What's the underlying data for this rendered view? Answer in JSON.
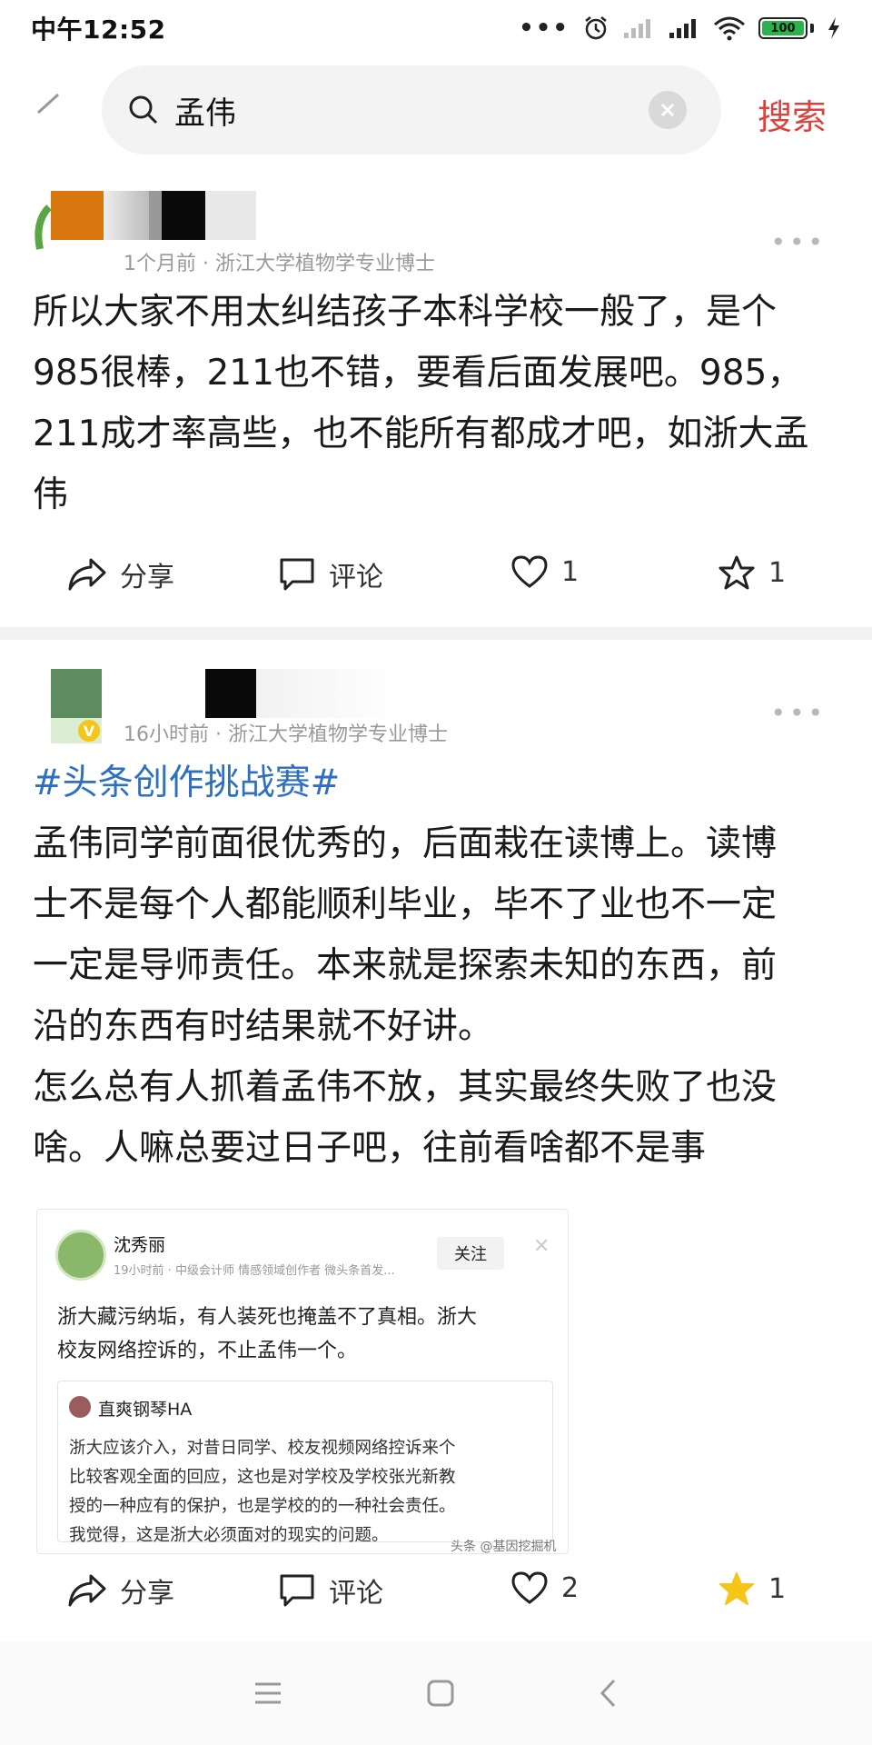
{
  "status_bar": {
    "time": "中午12:52",
    "battery": "100"
  },
  "search": {
    "query": "孟伟",
    "button_label": "搜索"
  },
  "posts": [
    {
      "meta": "1个月前 · 浙江大学植物学专业博士",
      "text_lines": [
        "所以大家不用太纠结孩子本科学校一般了，是个",
        "985很棒，211也不错，要看后面发展吧。985，",
        "211成才率高些，也不能所有都成才吧，如浙大孟",
        "伟"
      ],
      "actions": {
        "share": "分享",
        "comment": "评论",
        "likes": "1",
        "favorites": "1"
      }
    },
    {
      "meta": "16小时前 · 浙江大学植物学专业博士",
      "hashtag": "#头条创作挑战赛#",
      "text_lines": [
        "孟伟同学前面很优秀的，后面栽在读博上。读博",
        "士不是每个人都能顺利毕业，毕不了业也不一定",
        "一定是导师责任。本来就是探索未知的东西，前",
        "沿的东西有时结果就不好讲。",
        "怎么总有人抓着孟伟不放，其实最终失败了也没",
        "啥。人嘛总要过日子吧，往前看啥都不是事"
      ],
      "embed": {
        "name": "沈秀丽",
        "meta": "19小时前 · 中级会计师 情感领域创作者 微头条首发...",
        "follow": "关注",
        "text_lines": [
          "浙大藏污纳垢，有人装死也掩盖不了真相。浙大",
          "校友网络控诉的，不止孟伟一个。"
        ],
        "quote_name": "直爽钢琴HA",
        "quote_lines": [
          "浙大应该介入，对昔日同学、校友视频网络控诉来个",
          "比较客观全面的回应，这也是对学校及学校张光新教",
          "授的一种应有的保护，也是学校的的一种社会责任。",
          "我觉得，这是浙大必须面对的现实的问题。"
        ],
        "watermark": "头条 @基因挖掘机"
      },
      "actions": {
        "share": "分享",
        "comment": "评论",
        "likes": "2",
        "favorites": "1"
      }
    }
  ],
  "colors": {
    "accent_red": "#e0403a",
    "hashtag_blue": "#2d6fc0",
    "star_gold": "#f5c518"
  }
}
